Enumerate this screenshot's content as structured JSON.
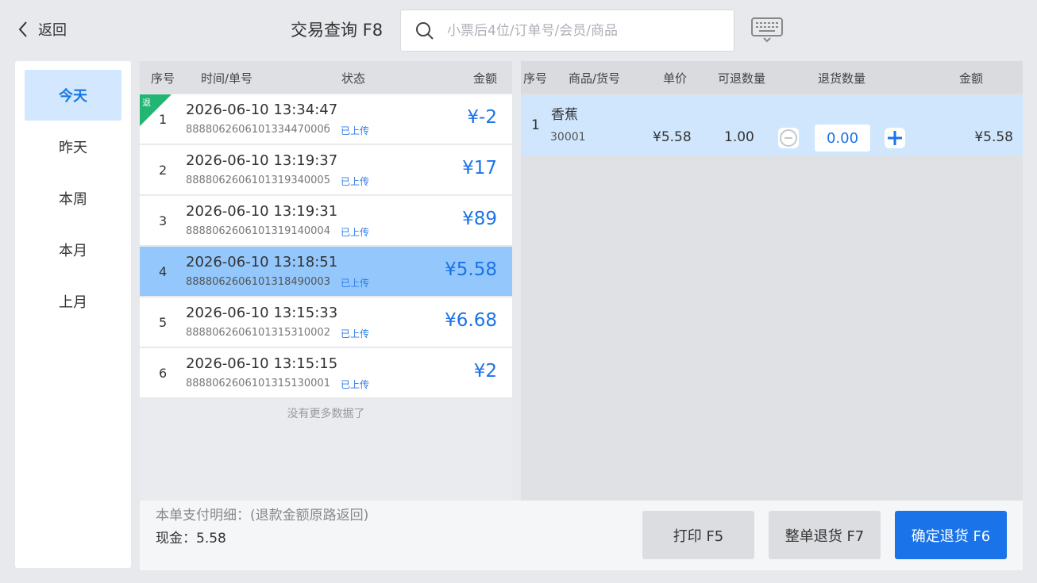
{
  "header": {
    "back_label": "返回",
    "title": "交易查询 F8",
    "search_placeholder": "小票后4位/订单号/会员/商品"
  },
  "dates": [
    "今天",
    "昨天",
    "本周",
    "本月",
    "上月"
  ],
  "active_date": "今天",
  "list_headers": {
    "index": "序号",
    "time": "时间/单号",
    "status": "状态",
    "amount": "金额"
  },
  "orders": [
    {
      "index": "1",
      "time": "2026-06-10 13:34:47",
      "order_no": "888806260610133447000б",
      "status": "已上传",
      "amount": "¥-2",
      "refund_tag": "退"
    },
    {
      "index": "2",
      "time": "2026-06-10 13:19:37",
      "order_no": "8888062606101319340005",
      "status": "已上传",
      "amount": "¥17"
    },
    {
      "index": "3",
      "time": "2026-06-10 13:19:31",
      "order_no": "8888062606101319140004",
      "status": "已上传",
      "amount": "¥89"
    },
    {
      "index": "4",
      "time": "2026-06-10 13:18:51",
      "order_no": "8888062606101318490003",
      "status": "已上传",
      "amount": "¥5.58",
      "selected": true
    },
    {
      "index": "5",
      "time": "2026-06-10 13:15:33",
      "order_no": "8888062606101315310002",
      "status": "已上传",
      "amount": "¥6.68"
    },
    {
      "index": "6",
      "time": "2026-06-10 13:15:15",
      "order_no": "8888062606101315130001",
      "status": "已上传",
      "amount": "¥2"
    }
  ],
  "no_more_text": "没有更多数据了",
  "detail_headers": {
    "index": "序号",
    "product": "商品/货号",
    "price": "单价",
    "returnable": "可退数量",
    "return_qty": "退货数量",
    "amount": "金额"
  },
  "detail_items": [
    {
      "index": "1",
      "name": "香蕉",
      "code": "30001",
      "price": "¥5.58",
      "returnable": "1.00",
      "return_qty": "0.00",
      "amount": "¥5.58"
    }
  ],
  "payment": {
    "title": "本单支付明细：(退款金额原路返回)",
    "cash": "现金：5.58"
  },
  "buttons": {
    "print": "打印 F5",
    "return_all": "整单退货 F7",
    "confirm": "确定退货 F6"
  },
  "colors": {
    "accent": "#1a73e8",
    "selected_row": "#94c7fc",
    "active_date_bg": "#d3e7ff",
    "refund_tag": "#22b573"
  },
  "icons": {
    "back": "chevron-left-icon",
    "search": "search-icon",
    "keyboard": "keyboard-icon",
    "minus": "minus-icon",
    "plus": "plus-icon"
  }
}
